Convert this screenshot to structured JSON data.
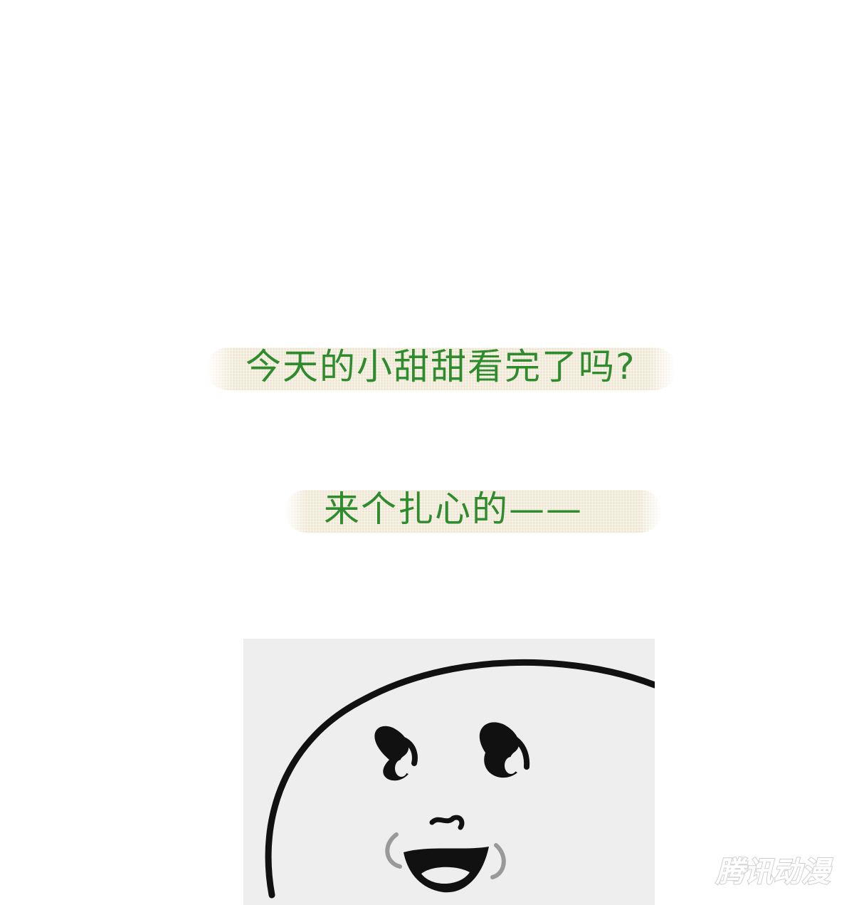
{
  "captions": {
    "line1": "今天的小甜甜看完了吗?",
    "line2": "来个扎心的——"
  },
  "colors": {
    "caption_text": "#2e8b2e",
    "bubble_fill": "#efe7d2",
    "panel_bg": "#eeeeee",
    "ink": "#111111"
  },
  "watermark": {
    "text": "腾讯动漫"
  }
}
